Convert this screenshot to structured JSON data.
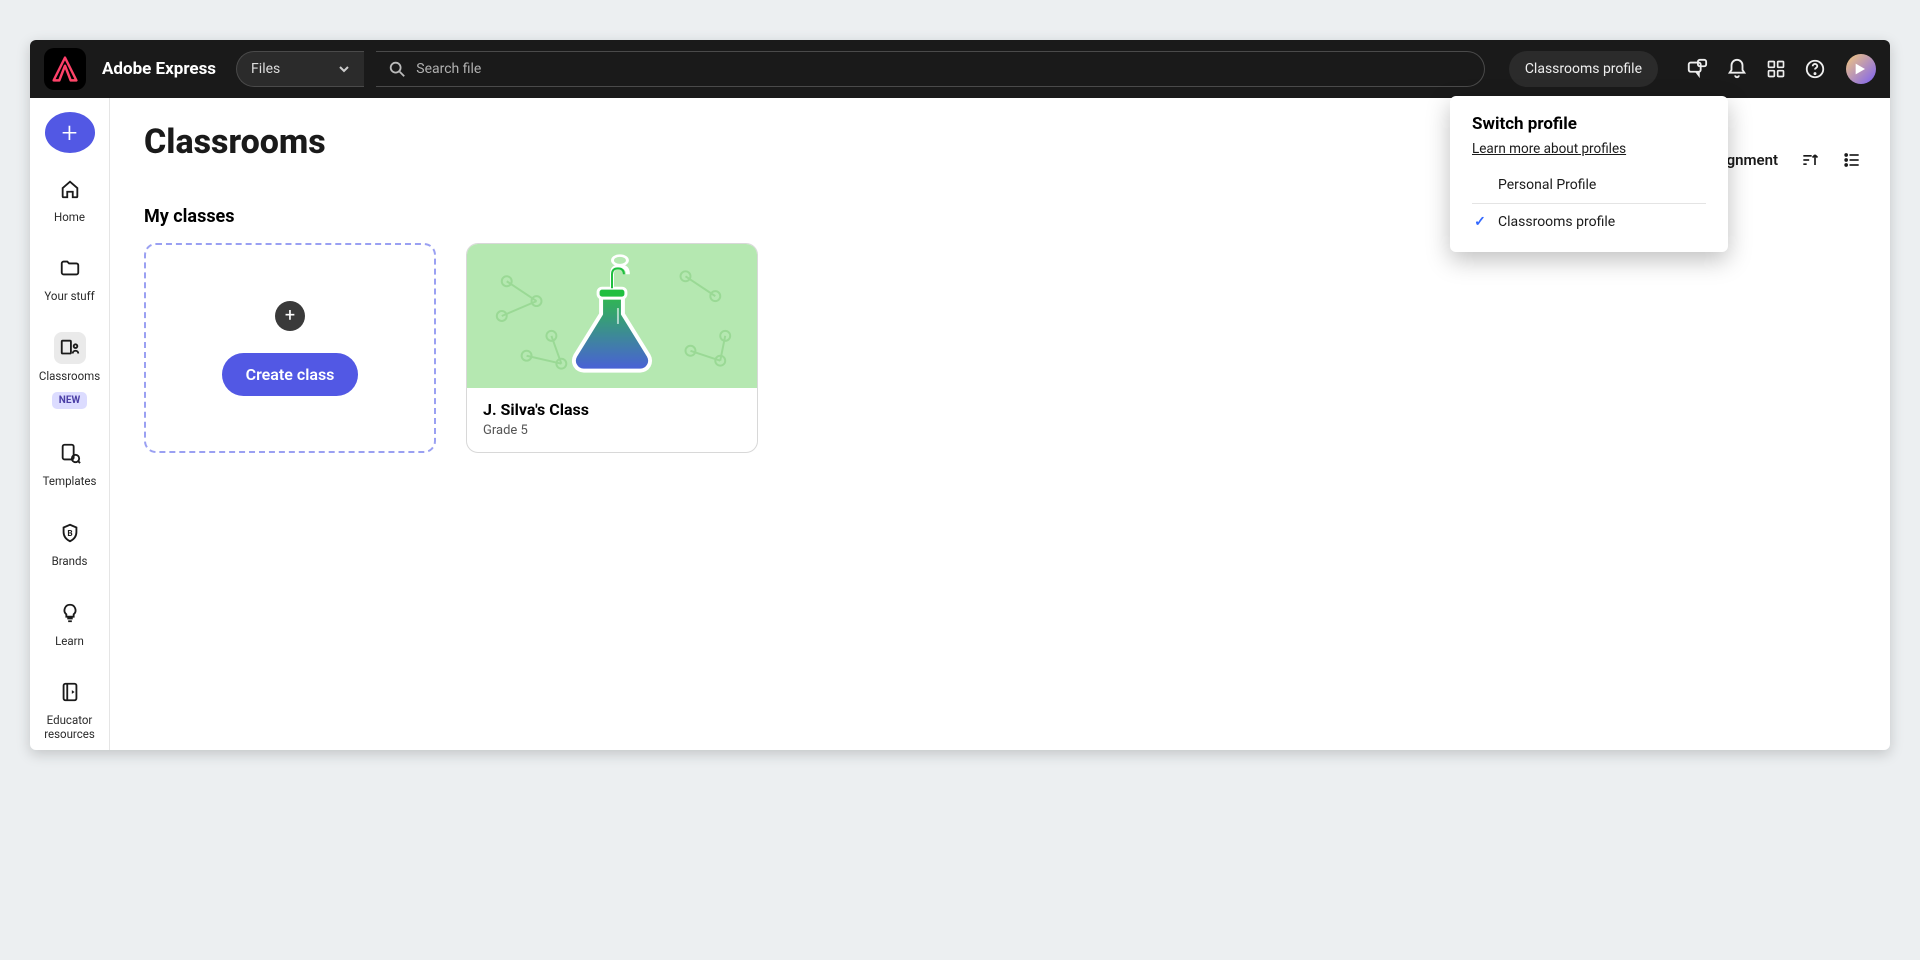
{
  "brand": {
    "name": "Adobe Express"
  },
  "search": {
    "scope": "Files",
    "placeholder": "Search file"
  },
  "topbar": {
    "profile_chip": "Classrooms profile"
  },
  "sidebar": {
    "home": "Home",
    "your_stuff": "Your stuff",
    "classrooms": "Classrooms",
    "classrooms_badge": "NEW",
    "templates": "Templates",
    "brands": "Brands",
    "learn": "Learn",
    "educator_resources": "Educator resources"
  },
  "page": {
    "title": "Classrooms",
    "create_assignment": "Create assignment",
    "my_classes": "My classes",
    "create_class_button": "Create class"
  },
  "classes": [
    {
      "name": "J. Silva's Class",
      "grade": "Grade 5"
    }
  ],
  "popover": {
    "title": "Switch profile",
    "learn_more": "Learn more about profiles",
    "personal": "Personal Profile",
    "classrooms": "Classrooms profile"
  }
}
